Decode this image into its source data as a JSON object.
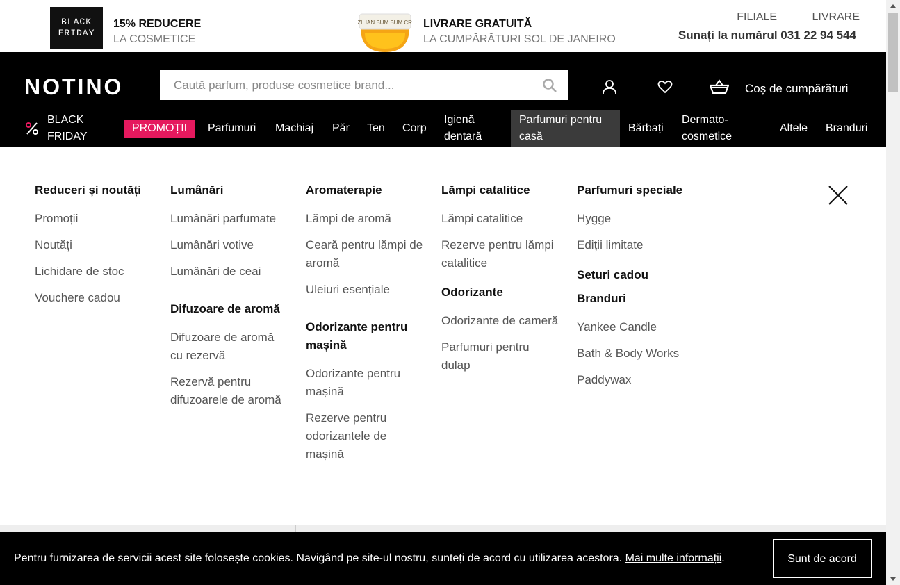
{
  "promos": [
    {
      "badge_line1": "BLACK",
      "badge_line2": "FRIDAY",
      "title": "15% REDUCERE",
      "subtitle": "LA COSMETICE"
    },
    {
      "product_text": "BRAZILIAN BUM BUM CREAM",
      "title": "LIVRARE GRATUITĂ",
      "subtitle": "LA CUMPĂRĂTURI SOL DE JANEIRO"
    }
  ],
  "top_links": {
    "stores": "FILIALE",
    "delivery": "LIVRARE"
  },
  "phone": "Sunați la numărul 031 22 94 544",
  "header": {
    "logo": "NOTINO",
    "search_placeholder": "Caută parfum, produse cosmetice brand...",
    "cart_label": "Coș de cumpărături"
  },
  "nav": {
    "black_friday_line1": "BLACK",
    "black_friday_line2": "FRIDAY",
    "items": [
      "PROMOȚII",
      "Parfumuri",
      "Machiaj",
      "Păr",
      "Ten",
      "Corp",
      "Igienă dentară",
      "Parfumuri pentru casă",
      "Bărbați",
      "Dermato-cosmetice",
      "Altele",
      "Branduri"
    ]
  },
  "menu": {
    "col1": {
      "h1": "Reduceri și noutăți",
      "items": [
        "Promoții",
        "Noutăți",
        "Lichidare de stoc",
        "Vouchere cadou"
      ]
    },
    "col2": {
      "h1": "Lumânări",
      "items1": [
        "Lumânări parfumate",
        "Lumânări votive",
        "Lumânări de ceai"
      ],
      "h2": "Difuzoare de aromă",
      "items2": [
        "Difuzoare de aromă cu rezervă",
        "Rezervă pentru difuzoarele de aromă"
      ]
    },
    "col3": {
      "h1": "Aromaterapie",
      "items1": [
        "Lămpi de aromă",
        "Ceară pentru lămpi de aromă",
        "Uleiuri esențiale"
      ],
      "h2": "Odorizante pentru mașină",
      "items2": [
        "Odorizante pentru mașină",
        "Rezerve pentru odorizantele de mașină"
      ]
    },
    "col4": {
      "h1": "Lămpi catalitice",
      "items1": [
        "Lămpi catalitice",
        "Rezerve pentru lămpi catalitice"
      ],
      "h2": "Odorizante",
      "items2": [
        "Odorizante de cameră",
        "Parfumuri pentru dulap"
      ]
    },
    "col5": {
      "h1": "Parfumuri speciale",
      "items1": [
        "Hygge",
        "Ediții limitate"
      ],
      "h2": "Seturi cadou",
      "h3": "Branduri",
      "items3": [
        "Yankee Candle",
        "Bath & Body Works",
        "Paddywax"
      ]
    }
  },
  "cookie": {
    "text": "Pentru furnizarea de servicii acest site folosește cookies. Navigând pe site-ul nostru, sunteți de acord cu utilizarea acestora.",
    "link": "Mai multe informații",
    "end": ".",
    "accept": "Sunt de acord"
  },
  "colors": {
    "accent": "#e5195e",
    "header_bg": "#000000",
    "active_nav_bg": "#3b3b3b"
  }
}
